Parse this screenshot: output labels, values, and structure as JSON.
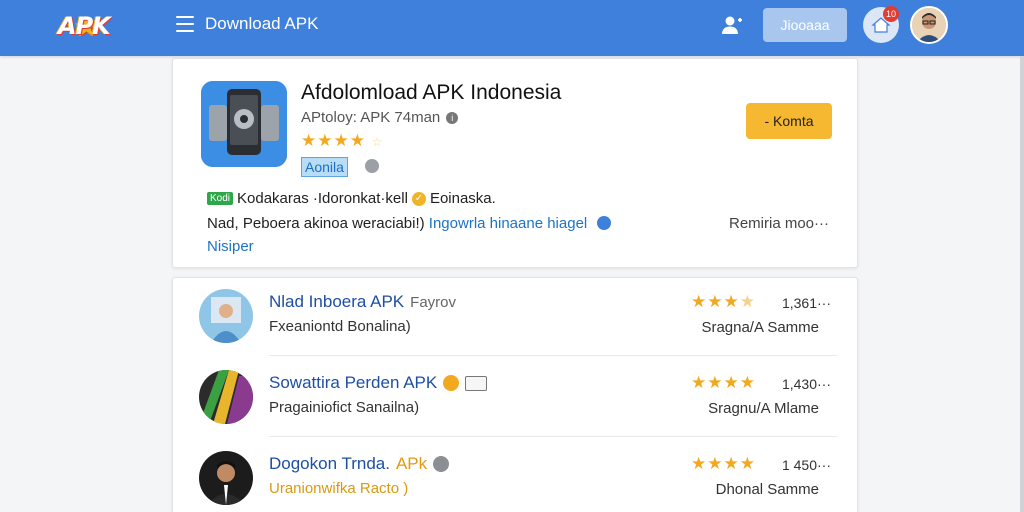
{
  "header": {
    "logo_text": "APK",
    "title": "Download APK",
    "join_label": "Jiooaaa",
    "notification_count": "10"
  },
  "main": {
    "title": "Afdolomload APK Indonesia",
    "subtitle": "APtoloy: APK 74man",
    "rating_stars": "★★★★",
    "rating_half": "☆",
    "tag": "Aonila",
    "action_label": "- Komta",
    "verify_badge": "Kodi",
    "verify_text": "Kodakaras ·Idoronkat·kell",
    "verify_suffix": "Eoinaska.",
    "desc_text": "Nad, Peboera akinoa weraciabi!)",
    "desc_link": "Ingowrla hinaane hiagel",
    "desc_more": "Nisiper",
    "meta_right": "Remiria moo···"
  },
  "list": [
    {
      "title": "Nlad Inboera APK",
      "title_extra": "Fayrov",
      "subtitle": "Fxeaniontd Bonalina)",
      "stars": "★★★",
      "stars_dim": "★",
      "count": "1,361···",
      "category": "Sragna/A Samme"
    },
    {
      "title": "Sowattira Perden APK",
      "title_extra": "",
      "subtitle": "Pragainiofict Sanailna)",
      "stars": "★★★★",
      "stars_dim": "",
      "count": "1,430···",
      "category": "Sragnu/A Mlame"
    },
    {
      "title": "Dogokon Trnda.",
      "title_extra": "APk",
      "subtitle": "Uranionwifka Racto )",
      "stars": "★★★★",
      "stars_dim": "",
      "count": "1 450···",
      "category": "Dhonal Samme"
    }
  ],
  "colors": {
    "topbar": "#3f80dc",
    "accent_yellow": "#f6b731",
    "star": "#f2a91f",
    "link": "#1d73c7"
  }
}
